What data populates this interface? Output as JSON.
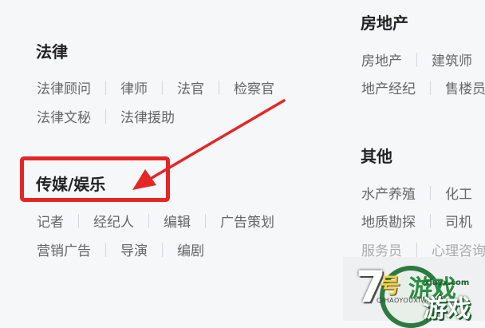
{
  "sections": {
    "law": {
      "title": "法律",
      "row1": [
        "法律顾问",
        "律师",
        "法官",
        "检察官"
      ],
      "row2": [
        "法律文秘",
        "法律援助"
      ]
    },
    "media": {
      "title": "传媒/娱乐",
      "row1": [
        "记者",
        "经纪人",
        "编辑",
        "广告策划"
      ],
      "row2": [
        "营销广告",
        "导演",
        "编剧"
      ]
    },
    "realestate": {
      "title": "房地产",
      "row1": [
        "房地产",
        "建筑师"
      ],
      "row2": [
        "地产经纪",
        "售楼员"
      ]
    },
    "other": {
      "title": "其他",
      "row1": [
        "水产养殖",
        "化工"
      ],
      "row2": [
        "地质勘探",
        "司机"
      ],
      "row3": [
        "服务员",
        "心理咨询"
      ]
    }
  },
  "annotation": {
    "box_color": "#e52626",
    "arrow_color": "#e52626"
  },
  "watermark": {
    "seven": "7",
    "hao": "号",
    "game": "游戏",
    "game2": "游戏",
    "pinyin": "QIHAOYOUXIWANG",
    "url": "xiayx.com"
  }
}
